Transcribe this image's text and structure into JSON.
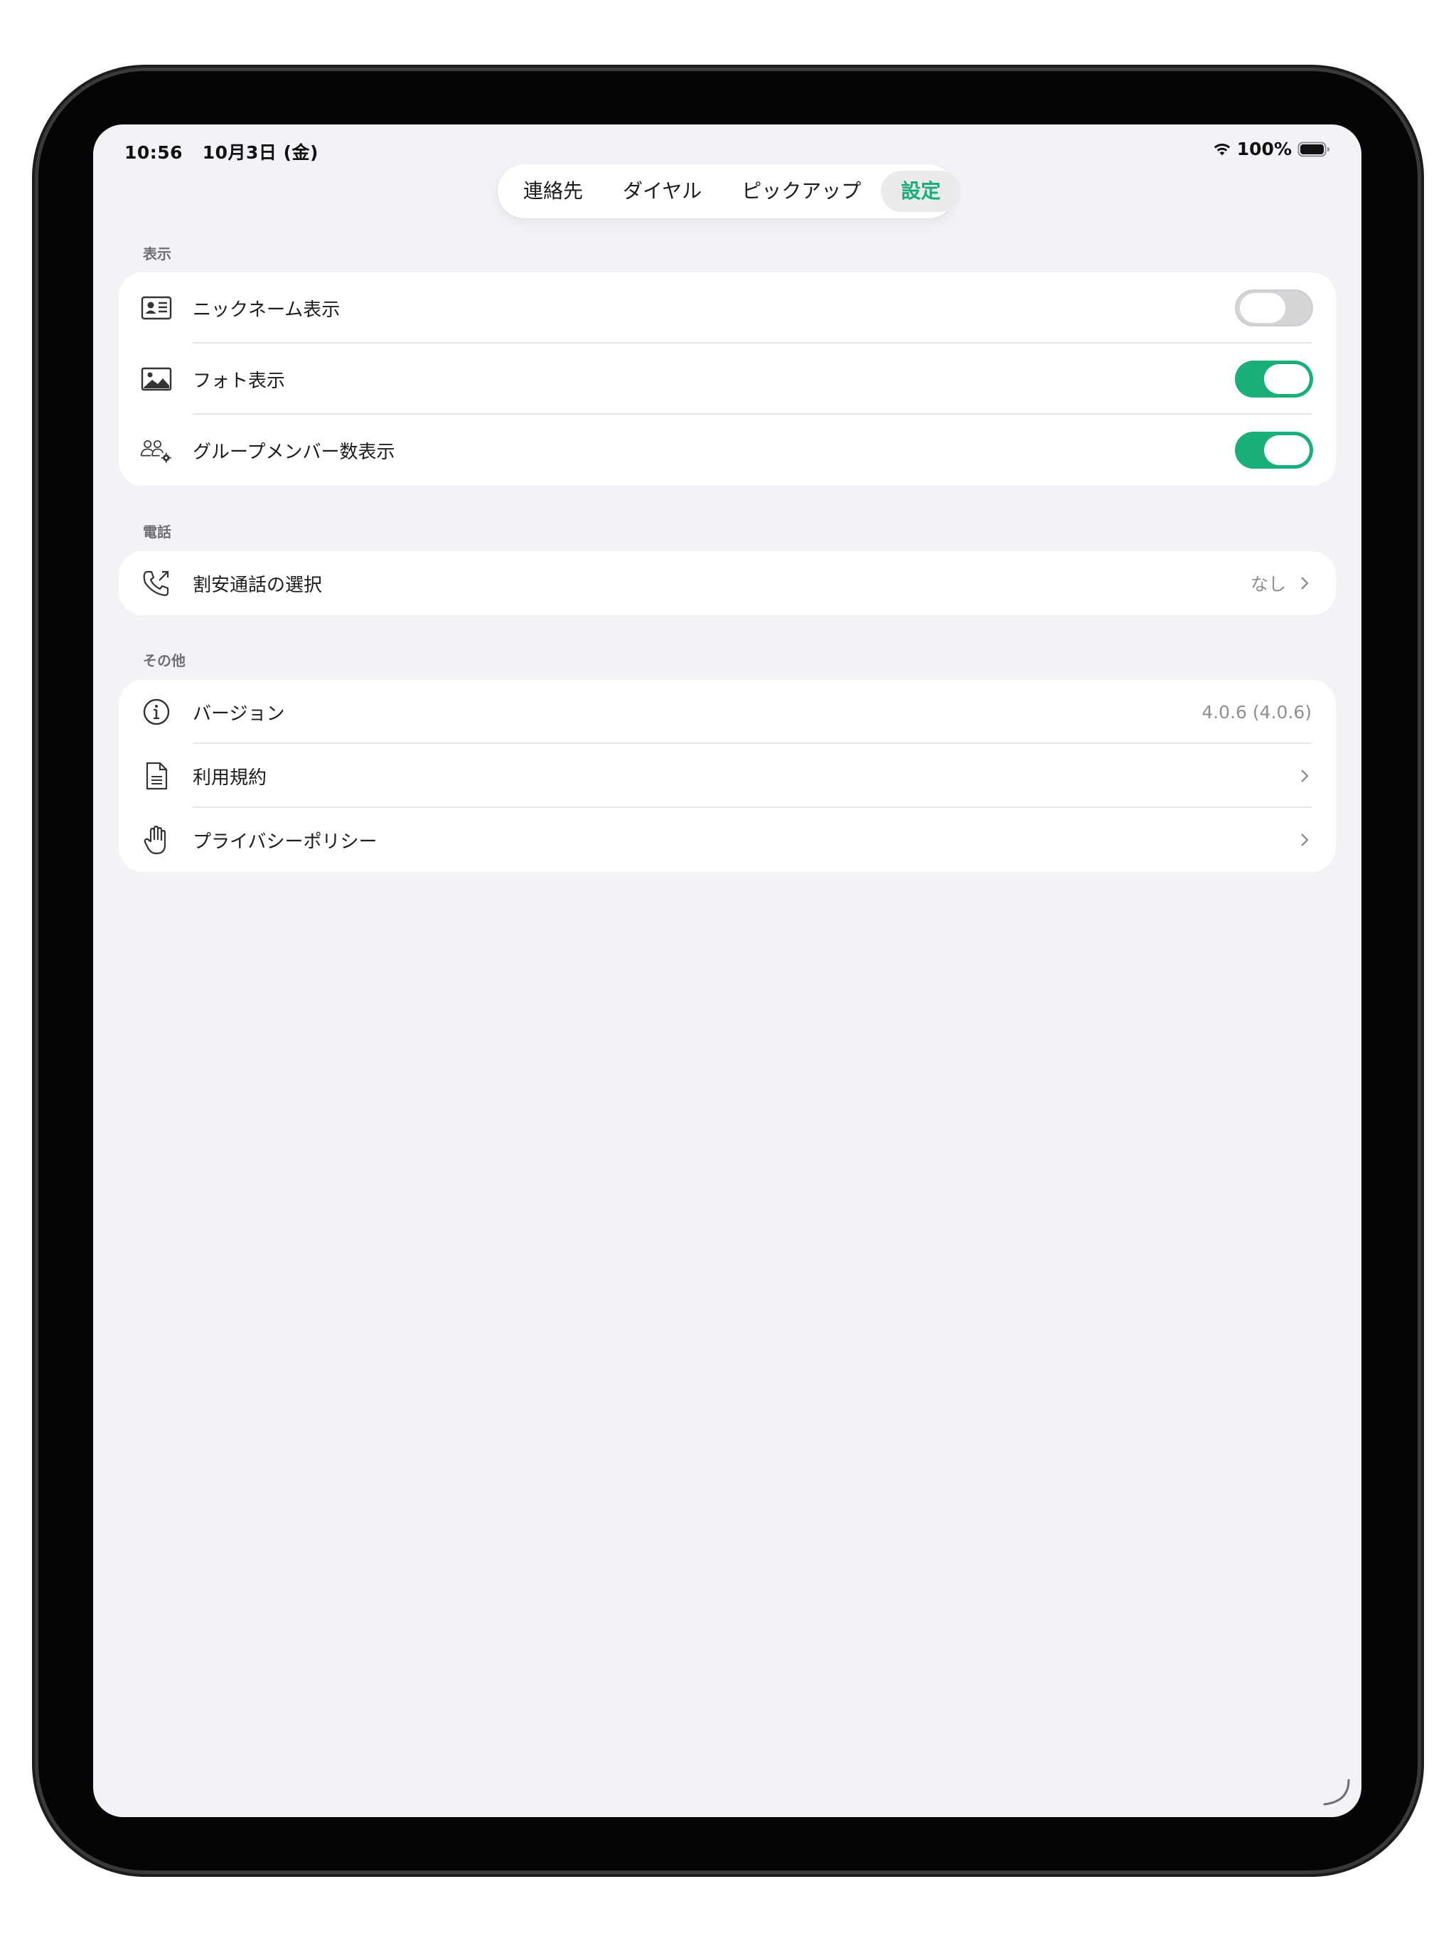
{
  "status_bar": {
    "time": "10:56",
    "date": "10月3日 (金)",
    "battery": "100%"
  },
  "tabs": [
    {
      "label": "連絡先",
      "active": false
    },
    {
      "label": "ダイヤル",
      "active": false
    },
    {
      "label": "ピックアップ",
      "active": false
    },
    {
      "label": "設定",
      "active": true
    }
  ],
  "colors": {
    "accent": "#1aae78",
    "background": "#f2f2f7",
    "card": "#ffffff"
  },
  "sections": {
    "display": {
      "header": "表示",
      "rows": [
        {
          "label": "ニックネーム表示",
          "icon": "contact-card-icon",
          "toggle": false
        },
        {
          "label": "フォト表示",
          "icon": "photo-icon",
          "toggle": true
        },
        {
          "label": "グループメンバー数表示",
          "icon": "group-settings-icon",
          "toggle": true
        }
      ]
    },
    "phone": {
      "header": "電話",
      "rows": [
        {
          "label": "割安通話の選択",
          "icon": "phone-outgoing-icon",
          "value": "なし"
        }
      ]
    },
    "other": {
      "header": "その他",
      "rows": [
        {
          "label": "バージョン",
          "icon": "info-icon",
          "value": "4.0.6 (4.0.6)"
        },
        {
          "label": "利用規約",
          "icon": "document-icon"
        },
        {
          "label": "プライバシーポリシー",
          "icon": "hand-icon"
        }
      ]
    }
  }
}
